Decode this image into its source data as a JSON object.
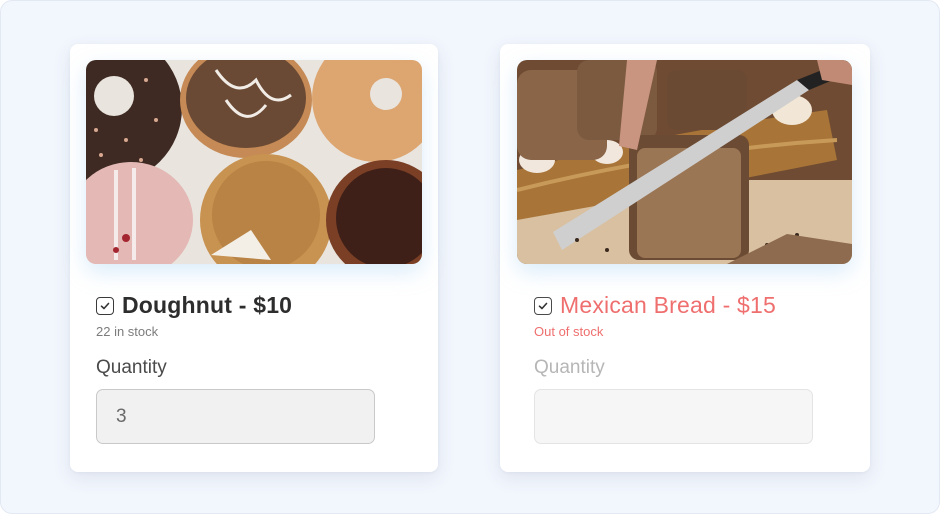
{
  "products": [
    {
      "title": "Doughnut - $10",
      "stock_text": "22 in stock",
      "quantity_label": "Quantity",
      "quantity_value": "3",
      "image_name": "doughnuts-photo",
      "in_stock": true
    },
    {
      "title": "Mexican Bread - $15",
      "stock_text": "Out of stock",
      "quantity_label": "Quantity",
      "quantity_value": "",
      "image_name": "bread-photo",
      "in_stock": false
    }
  ],
  "colors": {
    "page_background": "#f2f6fd",
    "out_of_stock_accent": "#ef6f6f",
    "text_primary": "#2d2d2d"
  }
}
